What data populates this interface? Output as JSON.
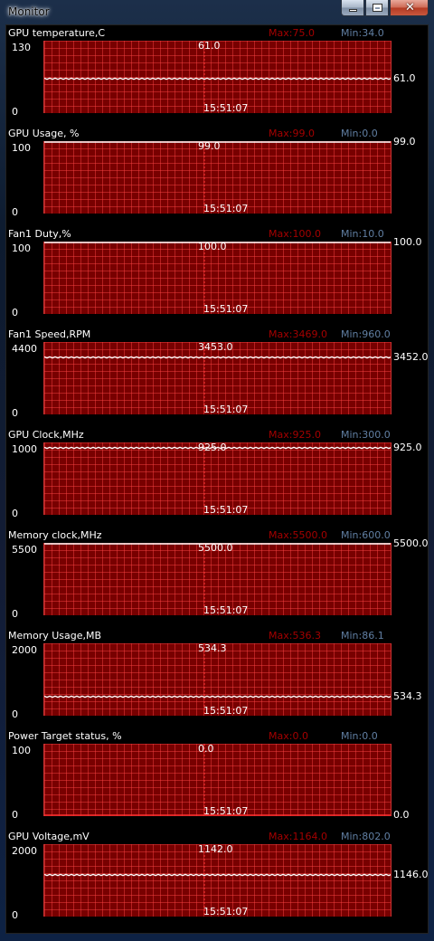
{
  "window": {
    "title": "Monitor",
    "close_glyph": "✕",
    "icons": {
      "minimize": "minimize-icon",
      "maximize": "maximize-icon",
      "close": "close-icon"
    }
  },
  "colors": {
    "plot_bg": "#780000",
    "grid": "#ff4646",
    "max_text": "#a40000",
    "min_text": "#617fa3",
    "trace": "#ffffff",
    "cursor": "#ff3333"
  },
  "panels": [
    {
      "title": "GPU temperature,C",
      "max": "Max:75.0",
      "min": "Min:34.0",
      "top": "130",
      "zero": "0",
      "current": "61.0",
      "cursor_value": "61.0",
      "time": "15:51:07",
      "level": 0.4692
    },
    {
      "title": "GPU Usage, %",
      "max": "Max:99.0",
      "min": "Min:0.0",
      "top": "100",
      "zero": "0",
      "current": "99.0",
      "cursor_value": "99.0",
      "time": "15:51:07",
      "level": 0.99
    },
    {
      "title": "Fan1 Duty,%",
      "max": "Max:100.0",
      "min": "Min:10.0",
      "top": "100",
      "zero": "0",
      "current": "100.0",
      "cursor_value": "100.0",
      "time": "15:51:07",
      "level": 1.0
    },
    {
      "title": "Fan1 Speed,RPM",
      "max": "Max:3469.0",
      "min": "Min:960.0",
      "top": "4400",
      "zero": "0",
      "current": "3452.0",
      "cursor_value": "3453.0",
      "time": "15:51:07",
      "level": 0.7845
    },
    {
      "title": "GPU Clock,MHz",
      "max": "Max:925.0",
      "min": "Min:300.0",
      "top": "1000",
      "zero": "0",
      "current": "925.0",
      "cursor_value": "925.0",
      "time": "15:51:07",
      "level": 0.925
    },
    {
      "title": "Memory clock,MHz",
      "max": "Max:5500.0",
      "min": "Min:600.0",
      "top": "5500",
      "zero": "0",
      "current": "5500.0",
      "cursor_value": "5500.0",
      "time": "15:51:07",
      "level": 1.0
    },
    {
      "title": "Memory Usage,MB",
      "max": "Max:536.3",
      "min": "Min:86.1",
      "top": "2000",
      "zero": "0",
      "current": "534.3",
      "cursor_value": "534.3",
      "time": "15:51:07",
      "level": 0.2672
    },
    {
      "title": "Power Target status, %",
      "max": "Max:0.0",
      "min": "Min:0.0",
      "top": "100",
      "zero": "0",
      "current": "0.0",
      "cursor_value": "0.0",
      "time": "15:51:07",
      "level": 0.0
    },
    {
      "title": "GPU Voltage,mV",
      "max": "Max:1164.0",
      "min": "Min:802.0",
      "top": "2000",
      "zero": "0",
      "current": "1146.0",
      "cursor_value": "1142.0",
      "time": "15:51:07",
      "level": 0.573
    }
  ]
}
